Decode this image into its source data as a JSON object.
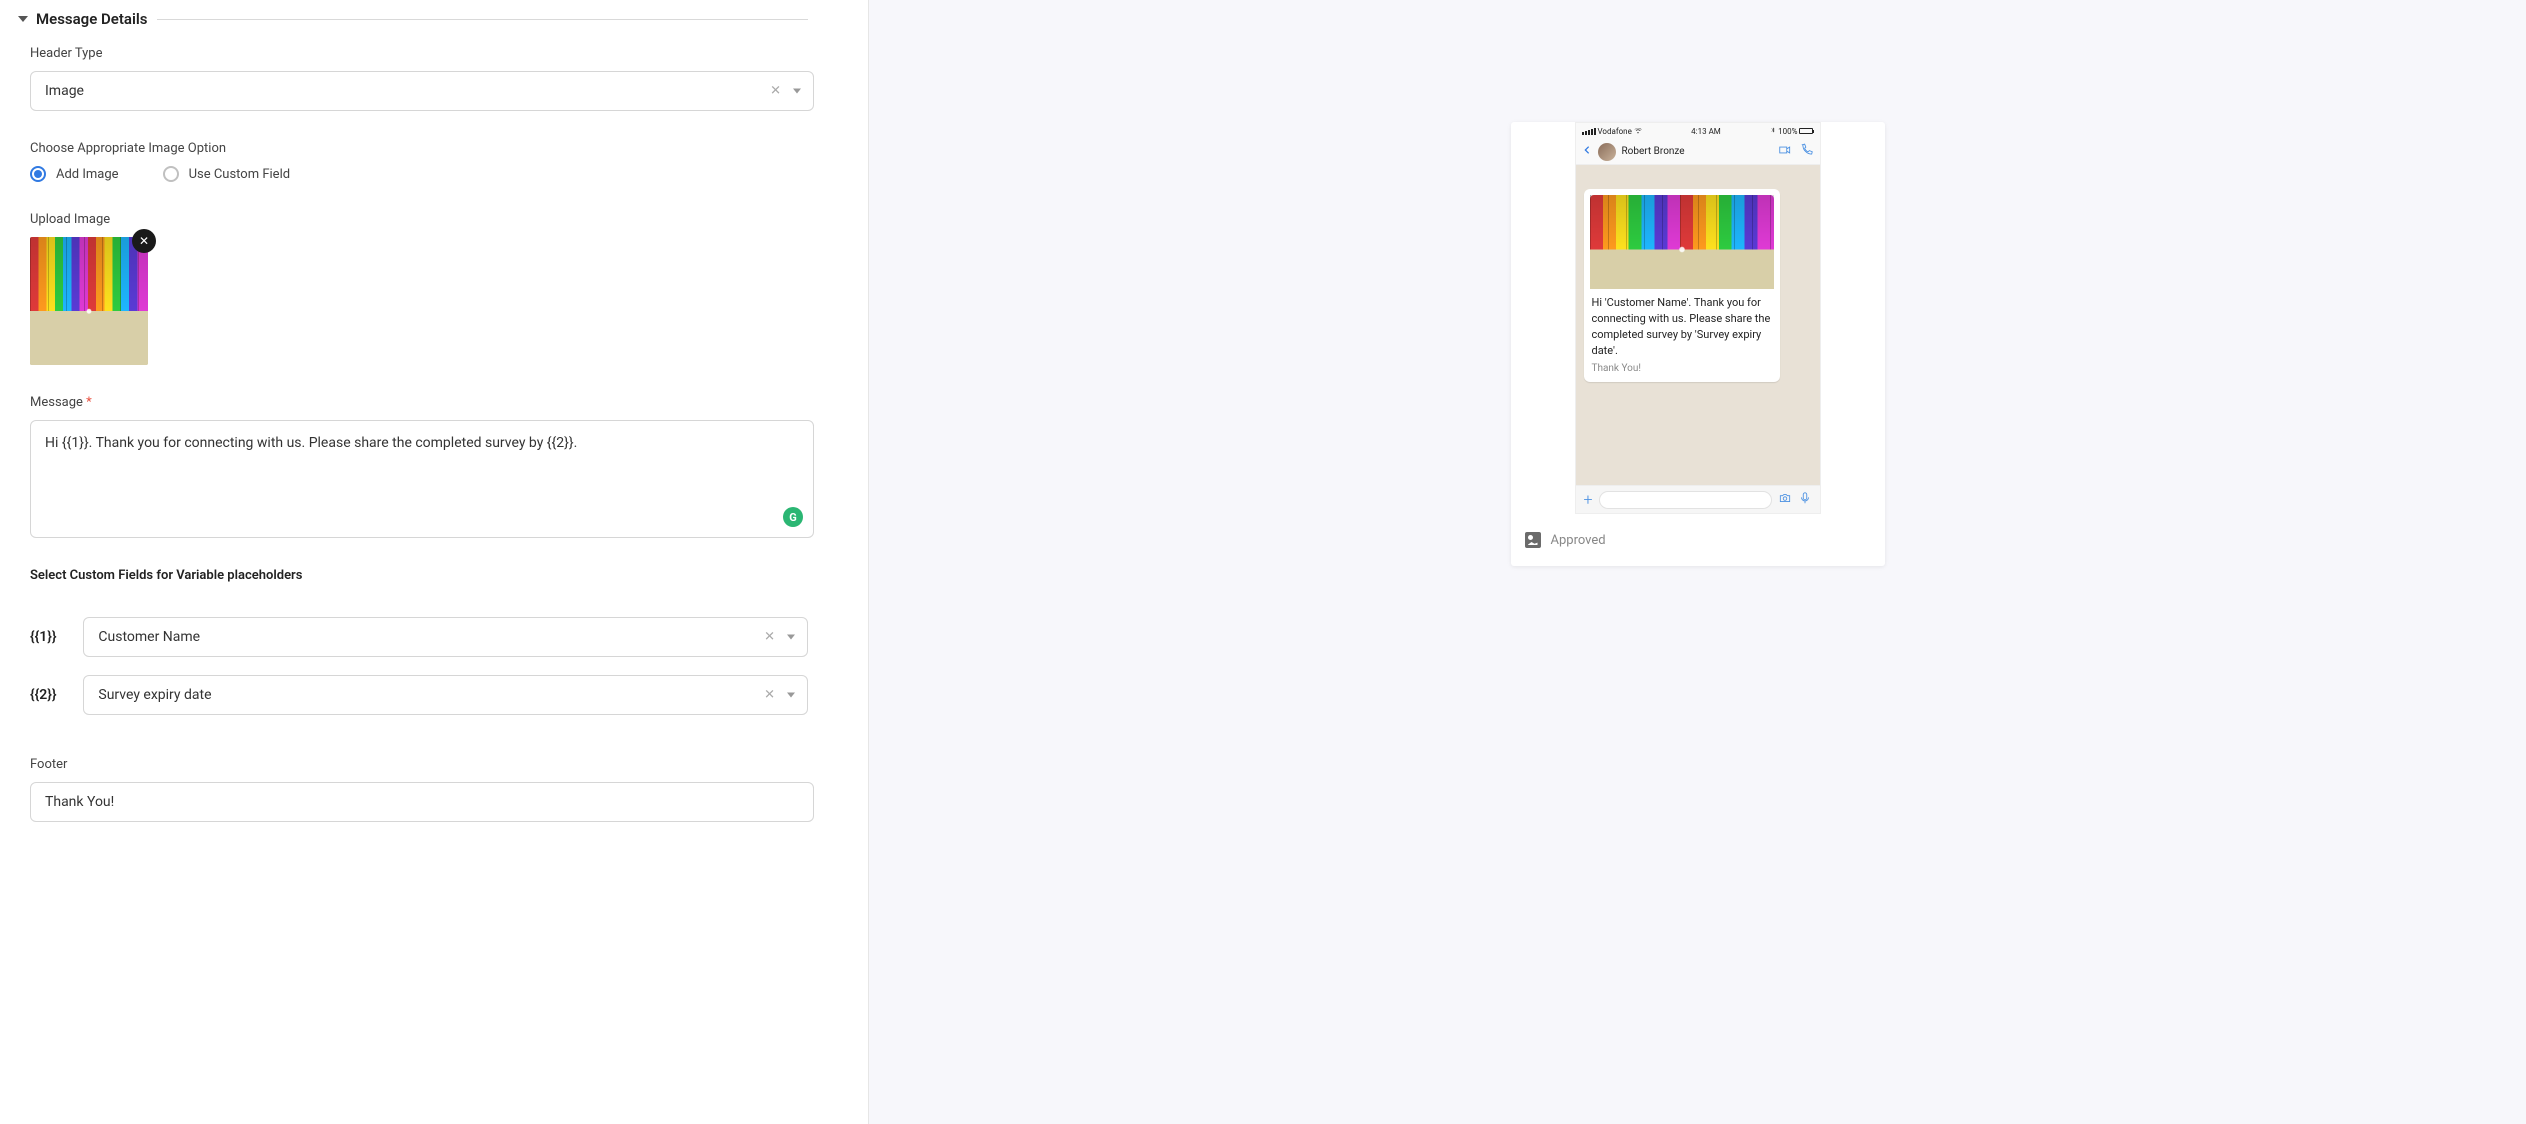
{
  "section": {
    "title": "Message Details"
  },
  "headerType": {
    "label": "Header Type",
    "value": "Image"
  },
  "imageOption": {
    "label": "Choose Appropriate Image Option",
    "options": {
      "addImage": "Add Image",
      "useCustomField": "Use Custom Field"
    },
    "selected": "addImage"
  },
  "uploadImage": {
    "label": "Upload Image"
  },
  "message": {
    "label": "Message",
    "value": "Hi {{1}}. Thank you for connecting with us. Please share the completed survey by {{2}}."
  },
  "customFields": {
    "heading": "Select Custom Fields for Variable placeholders",
    "var1": {
      "placeholder": "{{1}}",
      "value": "Customer Name"
    },
    "var2": {
      "placeholder": "{{2}}",
      "value": "Survey expiry date"
    }
  },
  "footer": {
    "label": "Footer",
    "value": "Thank You!"
  },
  "preview": {
    "statusBar": {
      "carrier": "Vodafone",
      "time": "4:13 AM",
      "battery": "100%"
    },
    "contactName": "Robert Bronze",
    "messageBody": "Hi 'Customer Name'. Thank you for connecting with us. Please share the completed survey by 'Survey expiry date'.",
    "footerText": "Thank You!",
    "status": "Approved"
  }
}
